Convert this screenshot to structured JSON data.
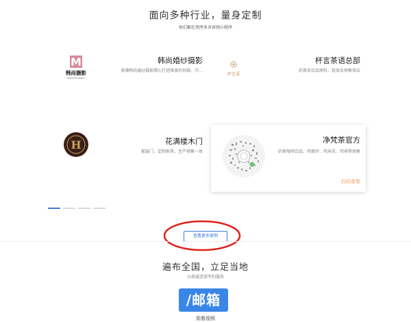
{
  "section1": {
    "title": "面向多种行业，量身定制",
    "subtitle": "他们都在用序多多官网小程序"
  },
  "cases": [
    {
      "name": "韩尚婚纱摄影",
      "desc": "美满韩尚婚纱摄影精心打造唯美的刹娘，只...",
      "logo_text": "韩尚摄影",
      "logo_mark": "M",
      "logo_sub": "HANS PHOTOGRAPHY"
    },
    {
      "name": "杯言茶语总部",
      "desc": "奶茶及饮品原料、批发及销售供应",
      "logo_text": "杯言语"
    },
    {
      "name": "花满楼木门",
      "desc": "套装门，定制家具，生产销售一体",
      "logo_mark": "H"
    },
    {
      "name": "净梵茶官方",
      "desc": "奶茶咖啡饮品、鸡蛋仔、鸡米花、鸡排等销售",
      "scan_label": "扫码查看"
    }
  ],
  "carousel": {
    "count": 4,
    "active": 0
  },
  "more_button": "查看更多案例",
  "section2": {
    "title": "遍布全国，立足当地",
    "subtitle": "沙商城连锁专利服务",
    "mail_label": "/邮箱",
    "video_link": "观看视频"
  },
  "colors": {
    "accent": "#3a7bd5",
    "ring": "#e0201a",
    "scan": "#f0a070",
    "mail_bg": "#3a86e8"
  }
}
